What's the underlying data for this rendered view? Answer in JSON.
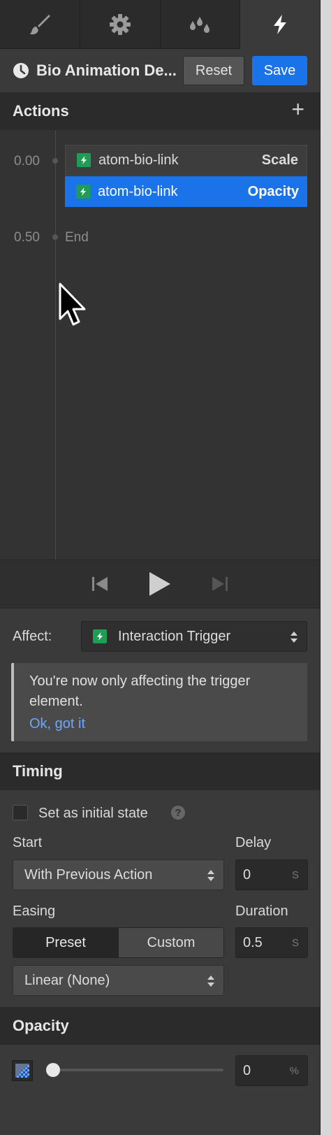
{
  "tabs": [
    {
      "icon": "brush-icon"
    },
    {
      "icon": "gear-icon"
    },
    {
      "icon": "drops-icon"
    },
    {
      "icon": "lightning-icon",
      "active": true
    }
  ],
  "header": {
    "title": "Bio Animation De...",
    "reset_label": "Reset",
    "save_label": "Save"
  },
  "actions": {
    "title": "Actions",
    "add_symbol": "+",
    "times": [
      "0.00",
      "0.50"
    ],
    "items": [
      {
        "name": "atom-bio-link",
        "property": "Scale",
        "selected": false
      },
      {
        "name": "atom-bio-link",
        "property": "Opacity",
        "selected": true
      }
    ],
    "end_label": "End"
  },
  "affect": {
    "label": "Affect:",
    "value": "Interaction Trigger",
    "notice_text": "You're now only affecting the trigger element.",
    "notice_link": "Ok, got it"
  },
  "timing": {
    "title": "Timing",
    "initial_state_label": "Set as initial state",
    "initial_state_checked": false,
    "help_symbol": "?",
    "start_label": "Start",
    "start_value": "With Previous Action",
    "delay_label": "Delay",
    "delay_value": "0",
    "delay_unit": "S",
    "easing_label": "Easing",
    "easing_options": [
      "Preset",
      "Custom"
    ],
    "easing_active": "Preset",
    "duration_label": "Duration",
    "duration_value": "0.5",
    "duration_unit": "S",
    "preset_value": "Linear (None)"
  },
  "opacity": {
    "title": "Opacity",
    "value": "0",
    "unit": "%",
    "level_fraction": 0
  },
  "colors": {
    "accent": "#1a73e8",
    "bolt_green": "#1f9d55",
    "link": "#6ea6ff"
  }
}
